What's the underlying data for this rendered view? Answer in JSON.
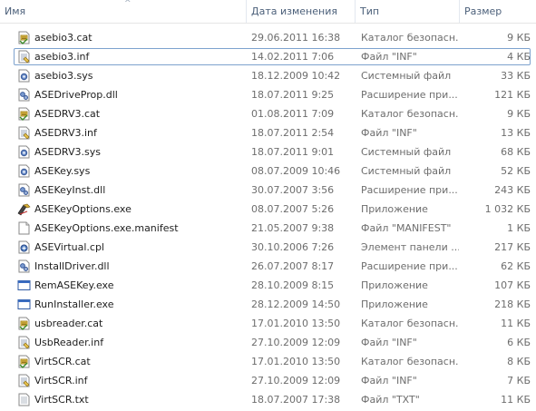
{
  "columns": {
    "name": "Имя",
    "date": "Дата изменения",
    "type": "Тип",
    "size": "Размер"
  },
  "files": [
    {
      "name": "asebio3.cat",
      "date": "29.06.2011 16:38",
      "type": "Каталог безопасн...",
      "size": "9 КБ",
      "icon": "security-catalog-icon"
    },
    {
      "name": "asebio3.inf",
      "date": "14.02.2011 7:06",
      "type": "Файл \"INF\"",
      "size": "4 КБ",
      "icon": "inf-file-icon",
      "selected": true
    },
    {
      "name": "asebio3.sys",
      "date": "18.12.2009 10:42",
      "type": "Системный файл",
      "size": "33 КБ",
      "icon": "system-file-icon"
    },
    {
      "name": "ASEDriveProp.dll",
      "date": "18.07.2011 9:25",
      "type": "Расширение при...",
      "size": "121 КБ",
      "icon": "dll-file-icon"
    },
    {
      "name": "ASEDRV3.cat",
      "date": "01.08.2011 7:09",
      "type": "Каталог безопасн...",
      "size": "9 КБ",
      "icon": "security-catalog-icon"
    },
    {
      "name": "ASEDRV3.inf",
      "date": "18.07.2011 2:54",
      "type": "Файл \"INF\"",
      "size": "13 КБ",
      "icon": "inf-file-icon"
    },
    {
      "name": "ASEDRV3.sys",
      "date": "18.07.2011 9:01",
      "type": "Системный файл",
      "size": "68 КБ",
      "icon": "system-file-icon"
    },
    {
      "name": "ASEKey.sys",
      "date": "08.07.2009 10:46",
      "type": "Системный файл",
      "size": "52 КБ",
      "icon": "system-file-icon"
    },
    {
      "name": "ASEKeyInst.dll",
      "date": "30.07.2007 3:56",
      "type": "Расширение при...",
      "size": "243 КБ",
      "icon": "dll-file-icon"
    },
    {
      "name": "ASEKeyOptions.exe",
      "date": "08.07.2007 5:26",
      "type": "Приложение",
      "size": "1 032 КБ",
      "icon": "app-exe-icon"
    },
    {
      "name": "ASEKeyOptions.exe.manifest",
      "date": "21.05.2007 9:38",
      "type": "Файл \"MANIFEST\"",
      "size": "1 КБ",
      "icon": "blank-file-icon"
    },
    {
      "name": "ASEVirtual.cpl",
      "date": "30.10.2006 7:26",
      "type": "Элемент панели ...",
      "size": "217 КБ",
      "icon": "control-panel-icon"
    },
    {
      "name": "InstallDriver.dll",
      "date": "26.07.2007 8:17",
      "type": "Расширение при...",
      "size": "62 КБ",
      "icon": "dll-file-icon"
    },
    {
      "name": "RemASEKey.exe",
      "date": "28.10.2009 8:15",
      "type": "Приложение",
      "size": "107 КБ",
      "icon": "window-exe-icon"
    },
    {
      "name": "RunInstaller.exe",
      "date": "28.12.2009 14:50",
      "type": "Приложение",
      "size": "218 КБ",
      "icon": "window-exe-icon"
    },
    {
      "name": "usbreader.cat",
      "date": "17.01.2010 13:50",
      "type": "Каталог безопасн...",
      "size": "11 КБ",
      "icon": "security-catalog-icon"
    },
    {
      "name": "UsbReader.inf",
      "date": "27.10.2009 12:09",
      "type": "Файл \"INF\"",
      "size": "6 КБ",
      "icon": "inf-file-icon"
    },
    {
      "name": "VirtSCR.cat",
      "date": "17.01.2010 13:50",
      "type": "Каталог безопасн...",
      "size": "8 КБ",
      "icon": "security-catalog-icon"
    },
    {
      "name": "VirtSCR.inf",
      "date": "27.10.2009 12:09",
      "type": "Файл \"INF\"",
      "size": "7 КБ",
      "icon": "inf-file-icon"
    },
    {
      "name": "VirtSCR.txt",
      "date": "18.07.2007 17:38",
      "type": "Файл \"TXT\"",
      "size": "11 КБ",
      "icon": "text-file-icon"
    }
  ]
}
